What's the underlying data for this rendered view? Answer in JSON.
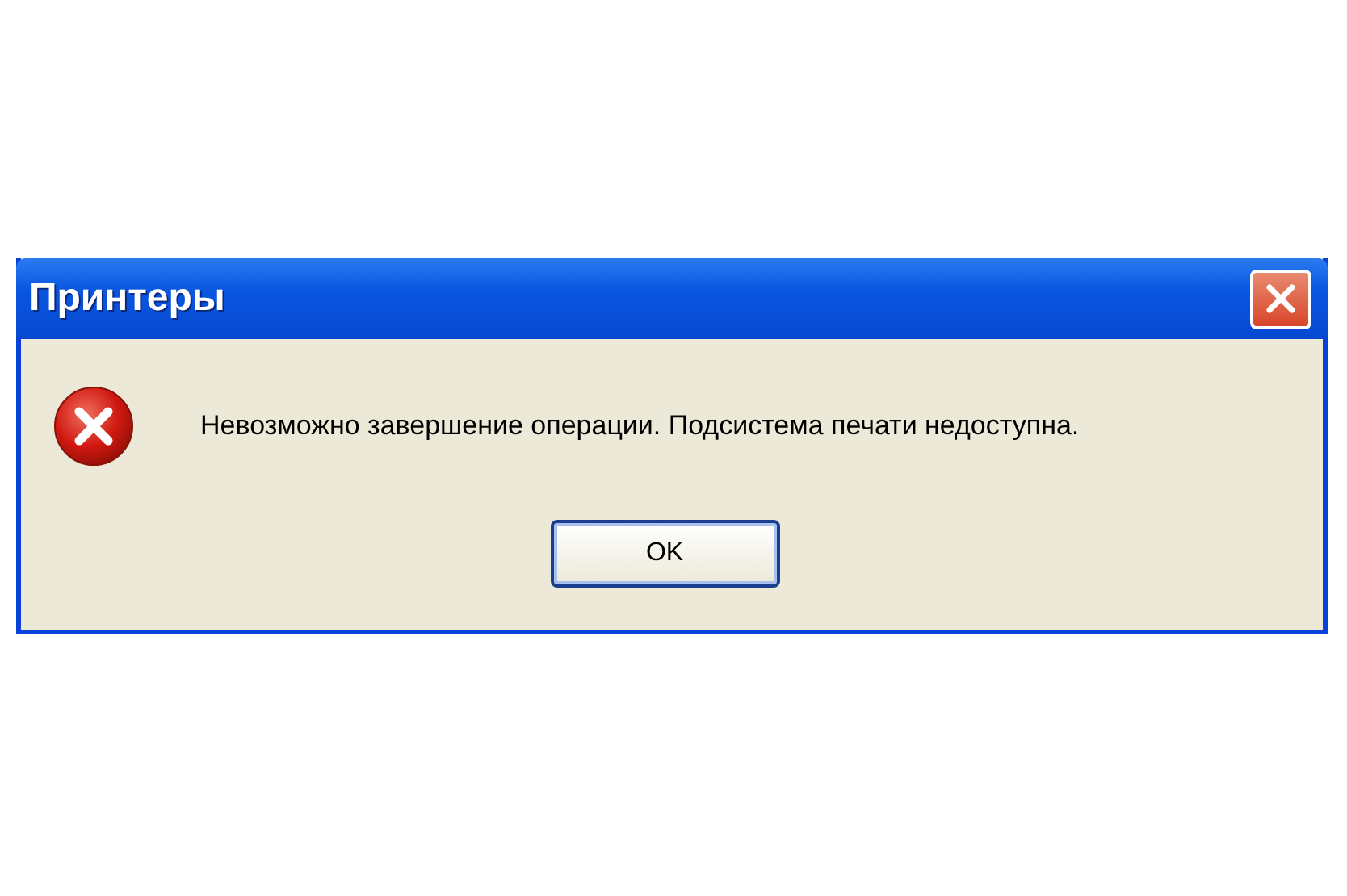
{
  "window": {
    "title": "Принтеры"
  },
  "message": "Невозможно завершение операции. Подсистема печати недоступна.",
  "buttons": [
    "OK"
  ]
}
